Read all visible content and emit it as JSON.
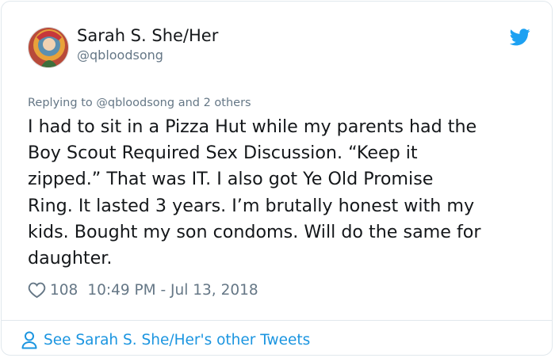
{
  "author": {
    "name": "Sarah S. She/Her",
    "handle": "@qbloodsong"
  },
  "reply_to": {
    "prefix": "Replying to",
    "handle": "@qbloodsong",
    "suffix": "and 2 others"
  },
  "tweet": {
    "lines": [
      "I had to sit in a Pizza Hut while my parents had the",
      "Boy Scout Required Sex Discussion.  “Keep it",
      "zipped.”  That was IT.  I also got Ye Old Promise",
      "Ring.  It lasted 3 years.  I’m brutally honest with my",
      "kids.  Bought my son condoms.  Will do the same for",
      "daughter."
    ]
  },
  "meta": {
    "like_count": "108",
    "timestamp": "10:49 PM - Jul 13, 2018"
  },
  "footer": {
    "link_text": "See Sarah S. She/Her's other Tweets"
  },
  "icons": {
    "bird": "twitter-bird-icon",
    "heart": "heart-outline-icon",
    "person": "person-icon"
  },
  "colors": {
    "brand_blue": "#1da1f2",
    "link_blue": "#1b95e0",
    "text": "#14171a",
    "muted": "#657786",
    "border": "#e1e8ed"
  }
}
